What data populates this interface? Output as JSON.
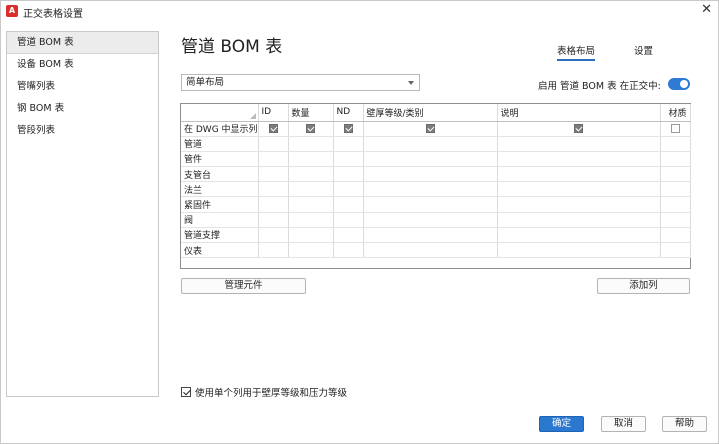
{
  "window": {
    "app_icon": "A",
    "title": "正交表格设置",
    "close_glyph": "✕"
  },
  "sidebar": {
    "items": [
      {
        "label": "管道 BOM 表",
        "active": true
      },
      {
        "label": "设备 BOM 表",
        "active": false
      },
      {
        "label": "管嘴列表",
        "active": false
      },
      {
        "label": "钢 BOM 表",
        "active": false
      },
      {
        "label": "管段列表",
        "active": false
      }
    ]
  },
  "main": {
    "title": "管道 BOM 表",
    "tabs": [
      {
        "label": "表格布局",
        "active": true
      },
      {
        "label": "设置",
        "active": false
      }
    ],
    "layout_select": {
      "value": "简单布局"
    },
    "enable_label": "启用  管道 BOM 表 在正交中:",
    "enable_toggle_on": true
  },
  "grid": {
    "columns": [
      "ID",
      "数量",
      "ND",
      "壁厚等级/类别",
      "说明",
      "材质"
    ],
    "rows": [
      {
        "label": "在 DWG 中显示列",
        "checks": [
          true,
          true,
          true,
          true,
          true,
          false
        ]
      },
      {
        "label": "管道",
        "checks": null
      },
      {
        "label": "管件",
        "checks": null
      },
      {
        "label": "支管台",
        "checks": null
      },
      {
        "label": "法兰",
        "checks": null
      },
      {
        "label": "紧固件",
        "checks": null
      },
      {
        "label": "阀",
        "checks": null
      },
      {
        "label": "管道支撑",
        "checks": null
      },
      {
        "label": "仪表",
        "checks": null
      }
    ]
  },
  "buttons": {
    "manage_components": "管理元件",
    "add_column": "添加列",
    "ok": "确定",
    "cancel": "取消",
    "help": "帮助"
  },
  "options": {
    "single_column_label": "使用单个列用于壁厚等级和压力等级",
    "single_column_checked": true
  },
  "colors": {
    "accent": "#2a78d0",
    "toggle_on": "#2f7bd4",
    "app_icon": "#d9302c"
  }
}
